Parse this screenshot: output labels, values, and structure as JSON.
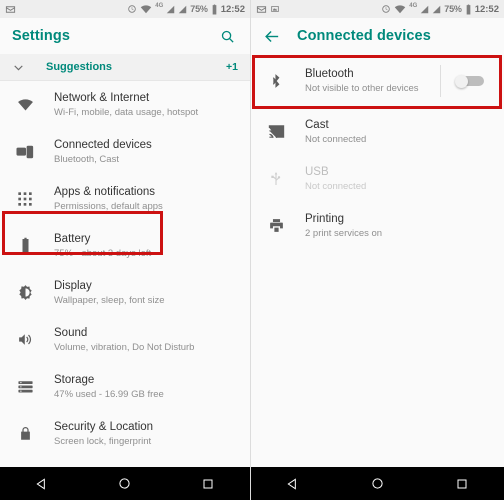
{
  "theme": {
    "accent": "#00897b",
    "highlight": "#cc1111",
    "statusbar_bg": "#eeeeee",
    "page_bg": "#fafafa",
    "icon_gray": "#5f5f5f",
    "disabled_gray": "#bdbdbd",
    "navbar_bg": "#000000"
  },
  "left_screen": {
    "statusbar": {
      "left_icons": [
        "envelope-icon"
      ],
      "alarm_icon": "alarm-icon",
      "wifi_icon": "wifi-icon",
      "network_type": "4G",
      "signal_icons": [
        "signal-bars-icon",
        "signal-bars-icon"
      ],
      "battery_percent": "75%",
      "battery_icon": "battery-icon",
      "time": "12:52"
    },
    "appbar": {
      "title": "Settings",
      "search_icon": "search-icon"
    },
    "suggestions": {
      "label": "Suggestions",
      "count": "+1",
      "chevron_icon": "chevron-down-icon"
    },
    "items": [
      {
        "icon": "wifi-icon",
        "title": "Network & Internet",
        "subtitle": "Wi-Fi, mobile, data usage, hotspot",
        "highlighted": false,
        "disabled": false
      },
      {
        "icon": "connected-devices-icon",
        "title": "Connected devices",
        "subtitle": "Bluetooth, Cast",
        "highlighted": true,
        "disabled": false
      },
      {
        "icon": "apps-grid-icon",
        "title": "Apps & notifications",
        "subtitle": "Permissions, default apps",
        "highlighted": false,
        "disabled": false
      },
      {
        "icon": "battery-icon",
        "title": "Battery",
        "subtitle": "75% - about 3 days left",
        "highlighted": false,
        "disabled": false
      },
      {
        "icon": "brightness-icon",
        "title": "Display",
        "subtitle": "Wallpaper, sleep, font size",
        "highlighted": false,
        "disabled": false
      },
      {
        "icon": "volume-icon",
        "title": "Sound",
        "subtitle": "Volume, vibration, Do Not Disturb",
        "highlighted": false,
        "disabled": false
      },
      {
        "icon": "storage-icon",
        "title": "Storage",
        "subtitle": "47% used - 16.99 GB free",
        "highlighted": false,
        "disabled": false
      },
      {
        "icon": "lock-icon",
        "title": "Security & Location",
        "subtitle": "Screen lock, fingerprint",
        "highlighted": false,
        "disabled": false
      }
    ],
    "navbar": {
      "back": "back-triangle-icon",
      "home": "home-circle-icon",
      "recents": "recents-square-icon"
    }
  },
  "right_screen": {
    "statusbar": {
      "left_icons": [
        "envelope-icon",
        "screenshot-icon"
      ],
      "alarm_icon": "alarm-icon",
      "wifi_icon": "wifi-icon",
      "network_type": "4G",
      "signal_icons": [
        "signal-bars-icon",
        "signal-bars-icon"
      ],
      "battery_percent": "75%",
      "battery_icon": "battery-icon",
      "time": "12:52"
    },
    "appbar": {
      "back_icon": "arrow-left-icon",
      "title": "Connected devices"
    },
    "items": [
      {
        "icon": "bluetooth-icon",
        "title": "Bluetooth",
        "subtitle": "Not visible to other devices",
        "toggle": "off",
        "highlighted": true,
        "disabled": false
      },
      {
        "icon": "cast-icon",
        "title": "Cast",
        "subtitle": "Not connected",
        "toggle": null,
        "highlighted": false,
        "disabled": false
      },
      {
        "icon": "usb-icon",
        "title": "USB",
        "subtitle": "Not connected",
        "toggle": null,
        "highlighted": false,
        "disabled": true
      },
      {
        "icon": "printer-icon",
        "title": "Printing",
        "subtitle": "2 print services on",
        "toggle": null,
        "highlighted": false,
        "disabled": false
      }
    ],
    "navbar": {
      "back": "back-triangle-icon",
      "home": "home-circle-icon",
      "recents": "recents-square-icon"
    }
  }
}
